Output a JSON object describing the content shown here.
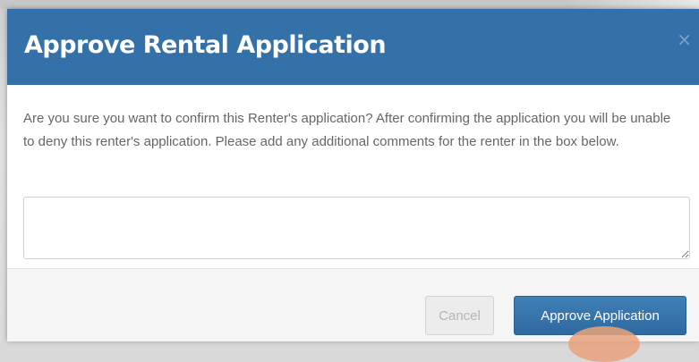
{
  "dialog": {
    "title": "Approve Rental Application",
    "close_symbol": "×",
    "message": "Are you sure you want to confirm this Renter's application? After confirming the application you will be unable to deny this renter's application. Please add any additional comments for the renter in the box below.",
    "comment_value": "",
    "cancel_label": "Cancel",
    "approve_label": "Approve Application"
  },
  "colors": {
    "header_bg": "#3371a8",
    "approve_button": "#2f6aa0",
    "cancel_button": "#ececec",
    "message_text": "#666666"
  },
  "icons": {
    "close": "close-icon"
  }
}
